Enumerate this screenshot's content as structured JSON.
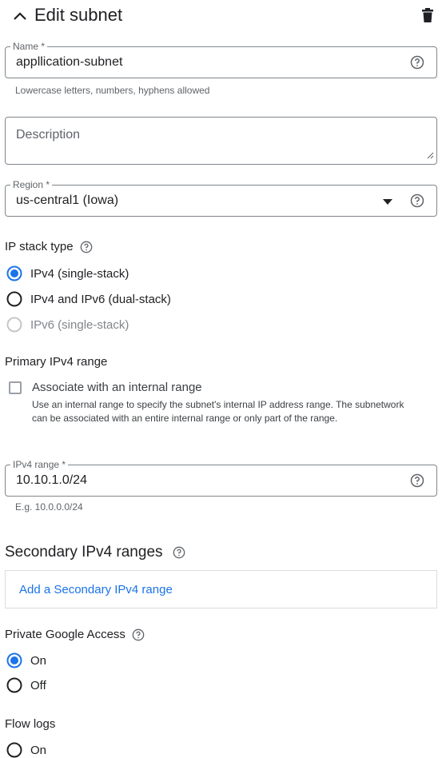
{
  "header": {
    "title": "Edit subnet"
  },
  "name_field": {
    "label": "Name *",
    "value": "appllication-subnet",
    "hint": "Lowercase letters, numbers, hyphens allowed"
  },
  "description_field": {
    "placeholder": "Description"
  },
  "region_field": {
    "label": "Region *",
    "value": "us-central1 (Iowa)"
  },
  "ip_stack": {
    "title": "IP stack type",
    "options": [
      {
        "label": "IPv4 (single-stack)",
        "selected": true,
        "disabled": false
      },
      {
        "label": "IPv4 and IPv6 (dual-stack)",
        "selected": false,
        "disabled": false
      },
      {
        "label": "IPv6 (single-stack)",
        "selected": false,
        "disabled": true
      }
    ]
  },
  "primary_range": {
    "title": "Primary IPv4 range",
    "checkbox_label": "Associate with an internal range",
    "checkbox_desc": "Use an internal range to specify the subnet's internal IP address range. The subnetwork can be associated with an entire internal range or only part of the range."
  },
  "ipv4_field": {
    "label": "IPv4 range *",
    "value": "10.10.1.0/24",
    "hint": "E.g. 10.0.0.0/24"
  },
  "secondary": {
    "title": "Secondary IPv4 ranges",
    "add_label": "Add a Secondary IPv4 range"
  },
  "private_access": {
    "title": "Private Google Access",
    "options": [
      {
        "label": "On",
        "selected": true
      },
      {
        "label": "Off",
        "selected": false
      }
    ]
  },
  "flow_logs": {
    "title": "Flow logs",
    "options": [
      {
        "label": "On",
        "selected": false
      }
    ]
  },
  "colors": {
    "accent": "#1a73e8",
    "border": "#80868b",
    "text": "#202124",
    "muted": "#5f6368"
  }
}
